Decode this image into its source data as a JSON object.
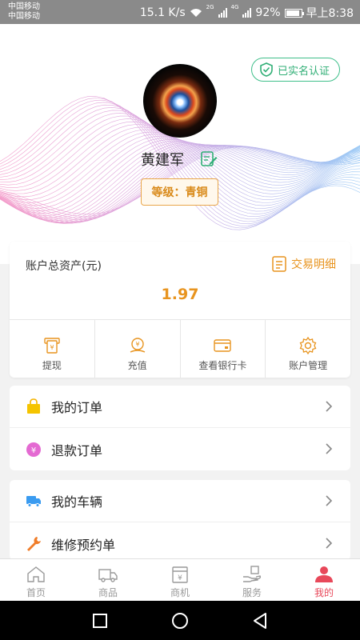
{
  "status_bar": {
    "carrier_1": "中国移动",
    "carrier_2": "中国移动",
    "speed": "15.1 K/s",
    "net_1": "2G",
    "net_2": "4G",
    "battery": "92%",
    "time": "早上8:38"
  },
  "profile": {
    "verified_label": "已实名认证",
    "username": "黄建军",
    "level_label": "等级：青铜"
  },
  "assets": {
    "label": "账户总资产(元)",
    "transactions_link": "交易明细",
    "total": "1.97",
    "actions": [
      {
        "label": "提现",
        "icon": "withdraw-icon"
      },
      {
        "label": "充值",
        "icon": "recharge-icon"
      },
      {
        "label": "查看银行卡",
        "icon": "bank-card-icon"
      },
      {
        "label": "账户管理",
        "icon": "gear-icon"
      }
    ]
  },
  "lists": {
    "group1": [
      {
        "label": "我的订单",
        "icon": "shopping-bag-icon"
      },
      {
        "label": "退款订单",
        "icon": "refund-icon"
      }
    ],
    "group2": [
      {
        "label": "我的车辆",
        "icon": "truck-icon"
      },
      {
        "label": "维修预约单",
        "icon": "wrench-icon"
      }
    ]
  },
  "tabbar": {
    "tabs": [
      {
        "label": "首页",
        "icon": "home-icon"
      },
      {
        "label": "商品",
        "icon": "truck-icon"
      },
      {
        "label": "商机",
        "icon": "opportunity-icon"
      },
      {
        "label": "服务",
        "icon": "service-icon"
      },
      {
        "label": "我的",
        "icon": "user-icon",
        "active": true
      }
    ]
  },
  "colors": {
    "accent": "#e8941f",
    "active_tab": "#e8485a",
    "verified": "#2fae75"
  }
}
